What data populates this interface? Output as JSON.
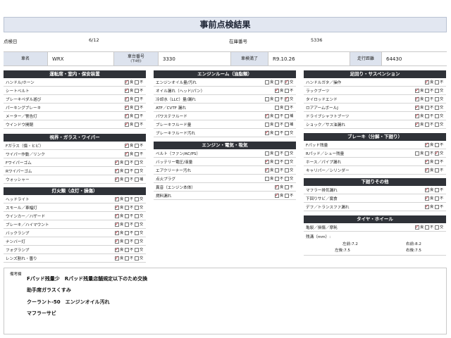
{
  "title": "事前点検結果",
  "info": {
    "date_label": "点検日",
    "date_value": "6/12",
    "stock_label": "在庫番号",
    "stock_value": "5336"
  },
  "vehicle": {
    "name_label": "車名",
    "name_value": "WRX",
    "chassis_label": "車台番号",
    "chassis_sub": "(下4桁)",
    "chassis_value": "3330",
    "inspection_label": "車検満了",
    "inspection_value": "R9.10.26",
    "mileage_label": "走行距離",
    "mileage_value": "64430"
  },
  "opt_labels": {
    "good": "良",
    "bad": "不",
    "replace": "交",
    "fill": "補"
  },
  "sections": {
    "driving": {
      "title": "運転席・室内・保安装置",
      "items": [
        {
          "name": "ハンドル/ホーン",
          "good": true,
          "bad": false
        },
        {
          "name": "シートベルト",
          "good": true,
          "bad": false
        },
        {
          "name": "ブレーキペダル遊び",
          "good": true,
          "bad": false
        },
        {
          "name": "パーキングブレーキ",
          "good": true,
          "bad": false
        },
        {
          "name": "メーター／警告灯",
          "good": true,
          "bad": false
        },
        {
          "name": "ウインドウ開閉",
          "good": true,
          "bad": false
        }
      ]
    },
    "visibility": {
      "title": "視界・ガラス・ワイパー",
      "items": [
        {
          "name": "Fガラス（傷・ヒビ）",
          "good": true,
          "bad": false
        },
        {
          "name": "ワイパー作動／リンク",
          "good": true,
          "bad": false
        },
        {
          "name": "Fワイパーゴム",
          "good": true,
          "bad": false,
          "replace": false
        },
        {
          "name": "Rワイパーゴム",
          "good": true,
          "bad": false,
          "replace": false
        },
        {
          "name": "ウォッシャー",
          "good": true,
          "bad": false,
          "fill": false
        }
      ]
    },
    "lights": {
      "title": "灯火類（点灯・損傷）",
      "items": [
        {
          "name": "ヘッドライト",
          "good": true,
          "bad": false,
          "replace": false
        },
        {
          "name": "スモール／車幅灯",
          "good": true,
          "bad": false,
          "replace": false
        },
        {
          "name": "ウインカー／ハザード",
          "good": true,
          "bad": false,
          "replace": false
        },
        {
          "name": "ブレーキ／ハイマウント",
          "good": true,
          "bad": false,
          "replace": false
        },
        {
          "name": "バックランプ",
          "good": true,
          "bad": false,
          "replace": false
        },
        {
          "name": "ナンバー灯",
          "good": true,
          "bad": false,
          "replace": false
        },
        {
          "name": "フォグランプ",
          "good": true,
          "bad": false,
          "replace": false
        },
        {
          "name": "レンズ割れ・曇り",
          "good": true,
          "bad": false,
          "replace": false
        }
      ]
    },
    "engine_room": {
      "title": "エンジンルーム（油脂類）",
      "items": [
        {
          "name": "エンジンオイル量/汚れ",
          "good": false,
          "bad": false,
          "replace": true
        },
        {
          "name": "オイル漏れ（ヘッド/パン）",
          "good": true,
          "bad": false
        },
        {
          "name": "冷却水（LLC）量/漏れ",
          "good": false,
          "bad": false,
          "replace": true
        },
        {
          "name": "ATF／CVTF 漏れ",
          "good": false,
          "bad": false
        },
        {
          "name": "パワステフルード",
          "good": true,
          "bad": false,
          "fill": false
        },
        {
          "name": "ブレーキフルード量",
          "good": false,
          "bad": false,
          "fill": false
        },
        {
          "name": "ブレーキフルード汚れ",
          "good": true,
          "bad": false,
          "replace": false
        }
      ]
    },
    "engine_elec": {
      "title": "エンジン・電気・吸気",
      "items": [
        {
          "name": "ベルト（ファン/AC/PS）",
          "good": false,
          "bad": false,
          "replace": false
        },
        {
          "name": "バッテリー電圧/液量",
          "good": true,
          "bad": false,
          "replace": false
        },
        {
          "name": "エアクリーナー汚れ",
          "good": true,
          "bad": false,
          "replace": false
        },
        {
          "name": "点火プラグ",
          "good": false,
          "bad": false,
          "replace": false
        },
        {
          "name": "異音（エンジン本体）",
          "good": true,
          "bad": false
        },
        {
          "name": "燃料漏れ",
          "good": true,
          "bad": false
        }
      ]
    },
    "suspension": {
      "title": "足回り・サスペンション",
      "items": [
        {
          "name": "ハンドルガタ／操作",
          "good": true,
          "bad": false
        },
        {
          "name": "ラックブーツ",
          "good": true,
          "bad": false,
          "replace": false
        },
        {
          "name": "タイロッドエンド",
          "good": true,
          "bad": false,
          "replace": false
        },
        {
          "name": "ロアアームボールJ",
          "good": true,
          "bad": false,
          "replace": false
        },
        {
          "name": "ドライブシャフトブーツ",
          "good": true,
          "bad": false,
          "replace": false
        },
        {
          "name": "ショック／サス油漏れ",
          "good": true,
          "bad": false,
          "replace": false
        }
      ]
    },
    "brakes": {
      "title": "ブレーキ（分解・下廻り）",
      "items": [
        {
          "name": "Fパッド残量",
          "good": true,
          "bad": false
        },
        {
          "name": "Rパッド／シュー残量",
          "good": false,
          "bad": false,
          "replace": true
        },
        {
          "name": "ホース／パイプ漏れ",
          "good": true,
          "bad": false
        },
        {
          "name": "キャリパー／シリンダー",
          "good": true,
          "bad": false
        }
      ]
    },
    "underbody": {
      "title": "下廻りその他",
      "items": [
        {
          "name": "マフラー排気漏れ",
          "good": true,
          "bad": false
        },
        {
          "name": "下回りサビ／腐食",
          "good": true,
          "bad": false
        },
        {
          "name": "デフ／トランスファ漏れ",
          "good": true,
          "bad": false
        }
      ]
    },
    "tires": {
      "title": "タイヤ・ホイール",
      "items": [
        {
          "name": "亀裂／損傷／摩耗",
          "good": true,
          "bad": false,
          "replace": false
        }
      ],
      "tread_label": "残溝（mm）:",
      "fl": "左前:7.2",
      "fr": "右前:8.2",
      "rl": "左後:7.5",
      "rr": "右後:7.5"
    }
  },
  "remarks": {
    "label": "備考欄",
    "lines": [
      "Fパッド残量少　Rパッド残量店舗規定以下のため交換",
      "助手席ガラスくすみ",
      "クーラント-50　エンジンオイル汚れ",
      "マフラーサビ"
    ]
  },
  "colors": {
    "header": "#2f3238",
    "title_bg": "#e2e7f1",
    "label_bg": "#dde3ee",
    "check": "#c0202a"
  }
}
